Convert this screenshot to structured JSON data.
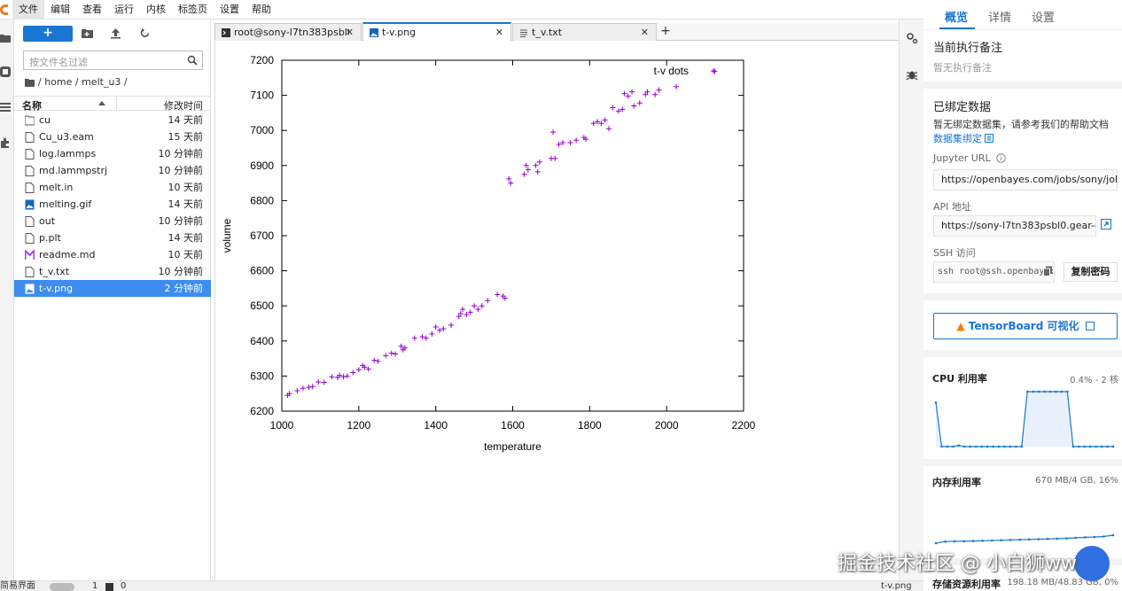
{
  "menubar": {
    "items": [
      "文件",
      "编辑",
      "查看",
      "运行",
      "内核",
      "标签页",
      "设置",
      "帮助"
    ]
  },
  "filebrowser": {
    "new_label": "+",
    "filter_placeholder": "按文件名过滤",
    "breadcrumb": "/ home / melt_u3 /",
    "col_name": "名称",
    "col_modified": "修改时间",
    "files": [
      {
        "name": "cu",
        "time": "14 天前",
        "icon": "folder-icon"
      },
      {
        "name": "Cu_u3.eam",
        "time": "15 天前",
        "icon": "file-icon"
      },
      {
        "name": "log.lammps",
        "time": "10 分钟前",
        "icon": "file-icon"
      },
      {
        "name": "md.lammpstrj",
        "time": "10 分钟前",
        "icon": "file-icon"
      },
      {
        "name": "melt.in",
        "time": "10 天前",
        "icon": "file-icon"
      },
      {
        "name": "melting.gif",
        "time": "14 天前",
        "icon": "image-icon"
      },
      {
        "name": "out",
        "time": "10 分钟前",
        "icon": "file-icon"
      },
      {
        "name": "p.plt",
        "time": "14 天前",
        "icon": "file-icon"
      },
      {
        "name": "readme.md",
        "time": "10 天前",
        "icon": "markdown-icon"
      },
      {
        "name": "t_v.txt",
        "time": "10 分钟前",
        "icon": "file-icon"
      },
      {
        "name": "t-v.png",
        "time": "2 分钟前",
        "icon": "image-icon",
        "selected": true
      }
    ]
  },
  "tabs": [
    {
      "label": "root@sony-l7tn383psbl0-ma",
      "icon": "terminal-icon"
    },
    {
      "label": "t-v.png",
      "icon": "image-icon",
      "active": true
    },
    {
      "label": "t_v.txt",
      "icon": "text-file-icon"
    }
  ],
  "tab_close": "✕",
  "tab_add": "+",
  "chart_data": {
    "type": "scatter",
    "title": "",
    "legend": "t-v dots",
    "legend_position": "top-right",
    "xlabel": "temperature",
    "ylabel": "volume",
    "xlim": [
      1000,
      2200
    ],
    "ylim": [
      6200,
      7200
    ],
    "xticks": [
      "1000",
      "1200",
      "1400",
      "1600",
      "1800",
      "2000",
      "2200"
    ],
    "yticks": [
      "6200",
      "6300",
      "6400",
      "6500",
      "6600",
      "6700",
      "6800",
      "6900",
      "7000",
      "7100",
      "7200"
    ],
    "marker": "+",
    "color": "#9400d3",
    "x": [
      1015,
      1020,
      1040,
      1055,
      1070,
      1080,
      1095,
      1110,
      1130,
      1145,
      1150,
      1160,
      1170,
      1185,
      1200,
      1210,
      1215,
      1225,
      1240,
      1250,
      1270,
      1285,
      1295,
      1310,
      1315,
      1320,
      1345,
      1365,
      1375,
      1390,
      1400,
      1410,
      1420,
      1440,
      1460,
      1465,
      1470,
      1480,
      1490,
      1500,
      1510,
      1520,
      1535,
      1560,
      1575,
      1580,
      1590,
      1595,
      1630,
      1635,
      1640,
      1660,
      1665,
      1670,
      1700,
      1705,
      1710,
      1720,
      1730,
      1750,
      1765,
      1785,
      1790,
      1810,
      1820,
      1830,
      1840,
      1850,
      1860,
      1875,
      1885,
      1890,
      1900,
      1910,
      1915,
      1930,
      1945,
      1950,
      1970,
      1980,
      2025,
      2125
    ],
    "y": [
      6245,
      6250,
      6258,
      6265,
      6268,
      6270,
      6283,
      6282,
      6298,
      6296,
      6302,
      6298,
      6300,
      6310,
      6318,
      6330,
      6325,
      6320,
      6345,
      6342,
      6358,
      6365,
      6363,
      6385,
      6375,
      6380,
      6408,
      6412,
      6408,
      6420,
      6440,
      6430,
      6435,
      6445,
      6470,
      6478,
      6490,
      6475,
      6482,
      6500,
      6490,
      6500,
      6515,
      6532,
      6528,
      6522,
      6862,
      6850,
      6875,
      6900,
      6888,
      6900,
      6882,
      6910,
      6920,
      6995,
      6920,
      6960,
      6965,
      6965,
      6972,
      6980,
      6975,
      7020,
      7025,
      7020,
      7030,
      7005,
      7065,
      7055,
      7060,
      7105,
      7098,
      7110,
      7070,
      7078,
      7102,
      7110,
      7102,
      7115,
      7125,
      7168
    ]
  },
  "right_panel": {
    "tabs": [
      "概览",
      "详情",
      "设置"
    ],
    "exec_note_title": "当前执行备注",
    "exec_note_empty": "暂无执行备注",
    "bound_data_title": "已绑定数据",
    "bound_data_text": "暂无绑定数据集，请参考我们的帮助文档",
    "bound_data_link": "数据集绑定",
    "jupyter_label": "Jupyter URL",
    "jupyter_url": "https://openbayes.com/jobs/sony/jobs",
    "api_label": "API 地址",
    "api_url": "https://sony-l7tn383psbl0.gear-c1.",
    "ssh_label": "SSH 访问",
    "ssh_value": "ssh root@ssh.openbaye:",
    "copy_password": "复制密码",
    "tensorboard": "TensorBoard 可视化",
    "cpu_title": "CPU 利用率",
    "cpu_value": "0.4% - 2 核",
    "mem_title": "内存利用率",
    "mem_value": "670 MB/4 GB, 16%",
    "storage_title": "存储资源利用率",
    "storage_value": "198.18 MB/48.83 GB, 0%",
    "cpu_series": [
      0.8,
      0.0,
      0.0,
      0.0,
      0.02,
      0.0,
      0.0,
      0.0,
      0.0,
      0.0,
      0.0,
      0.0,
      0.0,
      0.0,
      0.0,
      0.0,
      1.0,
      1.0,
      1.0,
      1.0,
      1.0,
      1.0,
      1.0,
      1.0,
      0.0,
      0.0,
      0.0,
      0.0,
      0.0,
      0.0,
      0.0,
      0.0
    ],
    "mem_series": [
      0.1,
      0.16,
      0.17,
      0.17,
      0.18,
      0.19,
      0.2,
      0.21,
      0.22,
      0.23,
      0.24,
      0.25,
      0.26,
      0.27,
      0.28,
      0.3,
      0.32,
      0.33,
      0.35,
      0.4
    ],
    "accent": "#1976d2"
  },
  "statusbar": {
    "simple_mode": "简易界面",
    "count1": "1",
    "count2": "0",
    "file": "t-v.png"
  },
  "watermark": "掘金技术社区 @ 小白狮ww"
}
